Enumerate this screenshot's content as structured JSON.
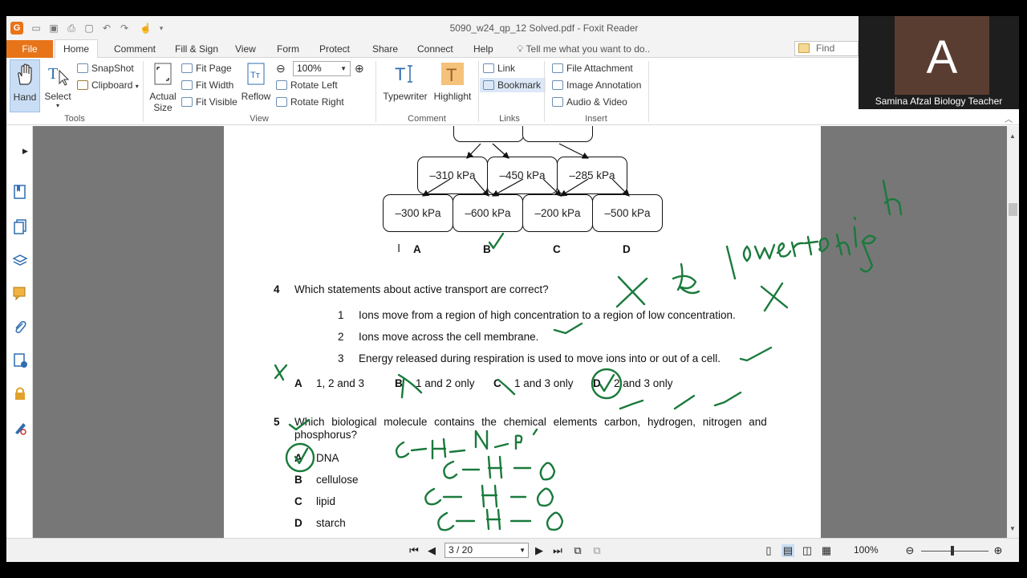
{
  "window": {
    "title": "5090_w24_qp_12 Solved.pdf - Foxit Reader"
  },
  "menu": {
    "file": "File",
    "tabs": [
      "Home",
      "Comment",
      "Fill & Sign",
      "View",
      "Form",
      "Protect",
      "Share",
      "Connect",
      "Help"
    ],
    "tell_me": "Tell me what you want to do..",
    "find_placeholder": "Find"
  },
  "ribbon": {
    "tools": {
      "label": "Tools",
      "hand": "Hand",
      "select": "Select",
      "snapshot": "SnapShot",
      "clipboard": "Clipboard"
    },
    "view": {
      "label": "View",
      "actual_size": "Actual Size",
      "fit_page": "Fit Page",
      "fit_width": "Fit Width",
      "fit_visible": "Fit Visible",
      "reflow": "Reflow",
      "zoom": "100%",
      "rotate_left": "Rotate Left",
      "rotate_right": "Rotate Right"
    },
    "comment": {
      "label": "Comment",
      "typewriter": "Typewriter",
      "highlight": "Highlight"
    },
    "links": {
      "label": "Links",
      "link": "Link",
      "bookmark": "Bookmark"
    },
    "insert": {
      "label": "Insert",
      "file_attachment": "File Attachment",
      "image_annotation": "Image Annotation",
      "audio_video": "Audio & Video"
    }
  },
  "document": {
    "diagram": {
      "row1": [
        "–310 kPa",
        "–450 kPa",
        "–285 kPa"
      ],
      "row2": [
        "–300 kPa",
        "–600 kPa",
        "–200 kPa",
        "–500 kPa"
      ],
      "options": [
        "A",
        "B",
        "C",
        "D"
      ]
    },
    "q4": {
      "number": "4",
      "question": "Which statements about active transport are correct?",
      "statements": [
        {
          "n": "1",
          "text": "Ions move from a region of high concentration to a region of low concentration."
        },
        {
          "n": "2",
          "text": "Ions move across the cell membrane."
        },
        {
          "n": "3",
          "text": "Energy released during respiration is used to move ions into or out of a cell."
        }
      ],
      "answers": [
        {
          "letter": "A",
          "text": "1, 2 and 3"
        },
        {
          "letter": "B",
          "text": "1 and 2 only"
        },
        {
          "letter": "C",
          "text": "1 and 3 only"
        },
        {
          "letter": "D",
          "text": "2 and 3 only"
        }
      ]
    },
    "q5": {
      "number": "5",
      "question_line1": "Which biological molecule contains the chemical elements carbon, hydrogen, nitrogen and",
      "question_line2": "phosphorus?",
      "answers": [
        {
          "letter": "A",
          "text": "DNA"
        },
        {
          "letter": "B",
          "text": "cellulose"
        },
        {
          "letter": "C",
          "text": "lipid"
        },
        {
          "letter": "D",
          "text": "starch"
        }
      ]
    }
  },
  "statusbar": {
    "page": "3 / 20",
    "zoom": "100%"
  },
  "webcam": {
    "initial": "A",
    "name": "Samina Afzal Biology Teacher"
  },
  "colors": {
    "accent": "#e8741a",
    "ink": "#1a7a3c"
  }
}
